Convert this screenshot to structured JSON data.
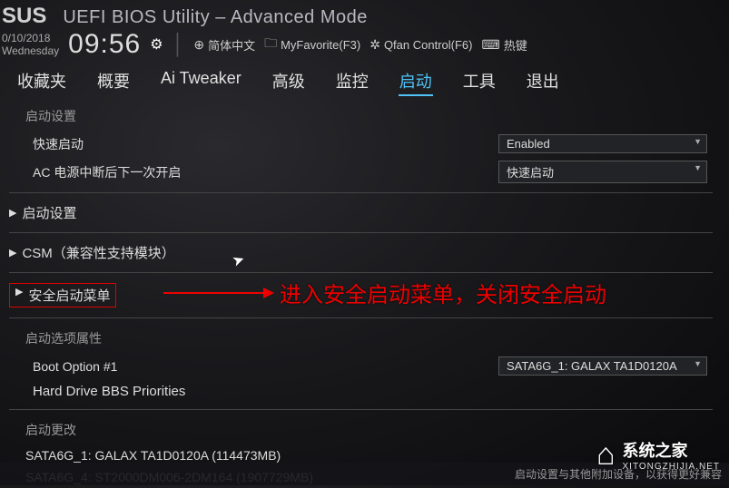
{
  "brand": "SUS",
  "title": "UEFI BIOS Utility – Advanced Mode",
  "date": "0/10/2018",
  "weekday": "Wednesday",
  "time": "09:56",
  "toolbar": {
    "lang": "简体中文",
    "fav": "MyFavorite(F3)",
    "qfan": "Qfan Control(F6)",
    "hotkey": "热键"
  },
  "tabs": {
    "fav": "收藏夹",
    "main": "概要",
    "aitweaker": "Ai Tweaker",
    "advanced": "高级",
    "monitor": "监控",
    "boot": "启动",
    "tool": "工具",
    "exit": "退出"
  },
  "sections": {
    "boot_cfg": "启动设置",
    "fastboot": "快速启动",
    "ac_loss": "AC 电源中断后下一次开启",
    "boot_cfg2": "启动设置",
    "csm": "CSM（兼容性支持模块）",
    "secure": "安全启动菜单",
    "boot_opt_prop": "启动选项属性",
    "boot_opt1": "Boot Option #1",
    "hdd_bbs": "Hard Drive BBS Priorities",
    "boot_change": "启动更改",
    "sata1": "SATA6G_1: GALAX TA1D0120A  (114473MB)",
    "sata4": "SATA6G_4: ST2000DM006-2DM164  (1907729MB)"
  },
  "dropdowns": {
    "fastboot_val": "Enabled",
    "ac_val": "快速启动",
    "boot_opt1_val": "SATA6G_1: GALAX TA1D0120A"
  },
  "annotation": "进入安全启动菜单，关闭安全启动",
  "watermark": {
    "main": "系统之家",
    "sub": "XITONGZHIJIA.NET"
  },
  "help_frag": "启动设置与其他附加设备，以获得更好兼容"
}
